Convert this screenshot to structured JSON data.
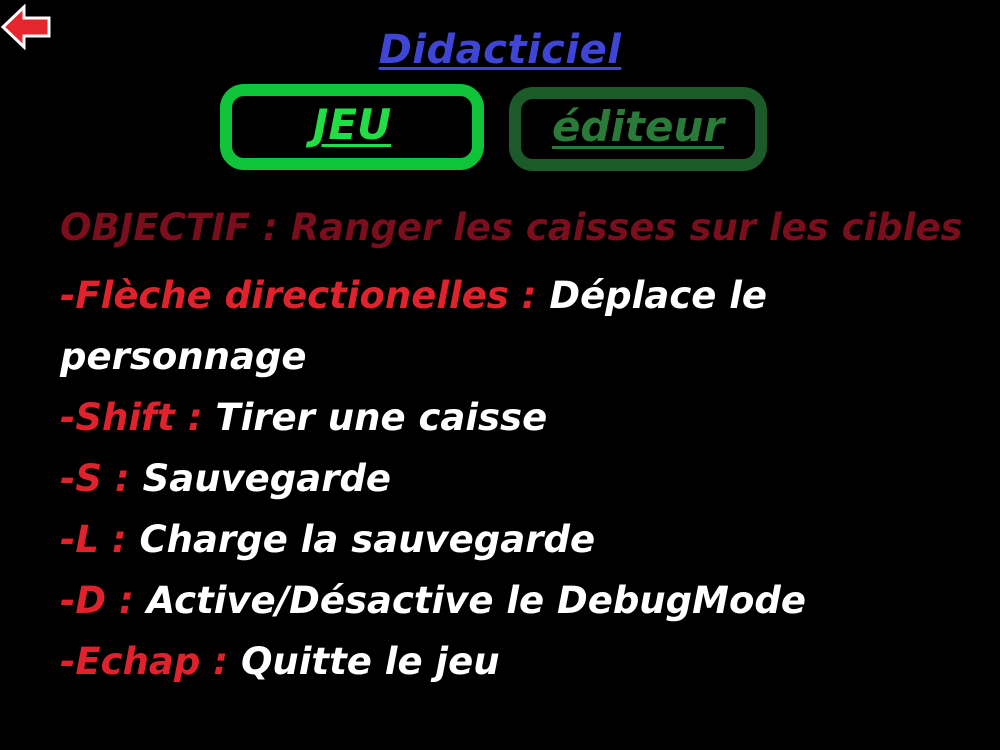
{
  "header": {
    "title": "Didacticiel",
    "back_icon": "red-left-arrow-icon"
  },
  "tabs": [
    {
      "label": "JEU",
      "selected": true
    },
    {
      "label": "éditeur",
      "selected": false
    }
  ],
  "objective": {
    "text": "OBJECTIF : Ranger les caisses sur les cibles"
  },
  "controls": [
    {
      "key": "-Flèche directionelles :",
      "action": "Déplace le personnage"
    },
    {
      "key": "-Shift :",
      "action": "Tirer une caisse"
    },
    {
      "key": "-S :",
      "action": "Sauvegarde"
    },
    {
      "key": "-L :",
      "action": "Charge la sauvegarde"
    },
    {
      "key": "-D :",
      "action": "Active/Désactive le DebugMode"
    },
    {
      "key": "-Echap :",
      "action": "Quitte le jeu"
    }
  ],
  "colors": {
    "background": "#000000",
    "title": "#3f45d4",
    "tab_active_border": "#10c43a",
    "tab_active_text": "#22dd44",
    "tab_inactive_border": "#1d5a2a",
    "tab_inactive_text": "#2a7a3a",
    "objective": "#7a0e1c",
    "key": "#e0222d",
    "action": "#ffffff",
    "arrow_fill": "#e6262e",
    "arrow_stroke": "#ffffff"
  }
}
